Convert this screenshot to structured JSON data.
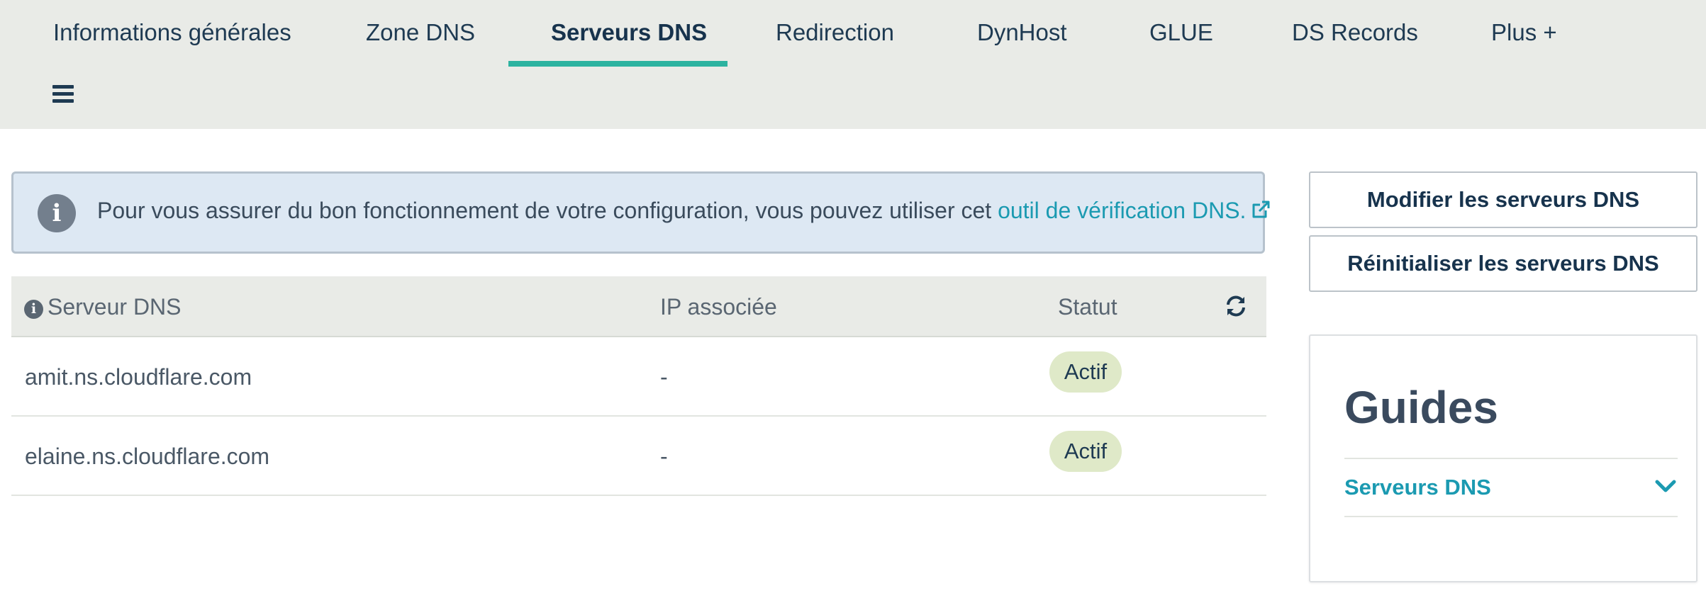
{
  "tabs": [
    {
      "label": "Informations générales",
      "active": false
    },
    {
      "label": "Zone DNS",
      "active": false
    },
    {
      "label": "Serveurs DNS",
      "active": true
    },
    {
      "label": "Redirection",
      "active": false
    },
    {
      "label": "DynHost",
      "active": false
    },
    {
      "label": "GLUE",
      "active": false
    },
    {
      "label": "DS Records",
      "active": false
    },
    {
      "label": "Plus +",
      "active": false
    }
  ],
  "menu": {
    "icon": "hamburger-menu-icon"
  },
  "alert": {
    "icon": "info-circle-icon",
    "text": "Pour vous assurer du bon fonctionnement de votre configuration, vous pouvez utiliser cet ",
    "link_text": "outil de vérification DNS.",
    "link_icon": "external-link-icon"
  },
  "table": {
    "headers": {
      "server": "Serveur DNS",
      "ip": "IP associée",
      "status": "Statut"
    },
    "header_icon": "info-circle-icon",
    "refresh_icon": "refresh-icon",
    "rows": [
      {
        "server": "amit.ns.cloudflare.com",
        "ip": "-",
        "status": "Actif"
      },
      {
        "server": "elaine.ns.cloudflare.com",
        "ip": "-",
        "status": "Actif"
      }
    ]
  },
  "actions": {
    "modify": "Modifier les serveurs DNS",
    "reset": "Réinitialiser les serveurs DNS"
  },
  "guides": {
    "title": "Guides",
    "items": [
      {
        "label": "Serveurs DNS",
        "icon": "chevron-down-icon"
      }
    ]
  },
  "colors": {
    "accent": "#2cb3a0",
    "link": "#1b9ab1",
    "tabbar_bg": "#e9ebe7",
    "alert_bg": "#dde8f3",
    "status_badge_bg": "#dfe9c8",
    "text_dark": "#1e3a52"
  }
}
